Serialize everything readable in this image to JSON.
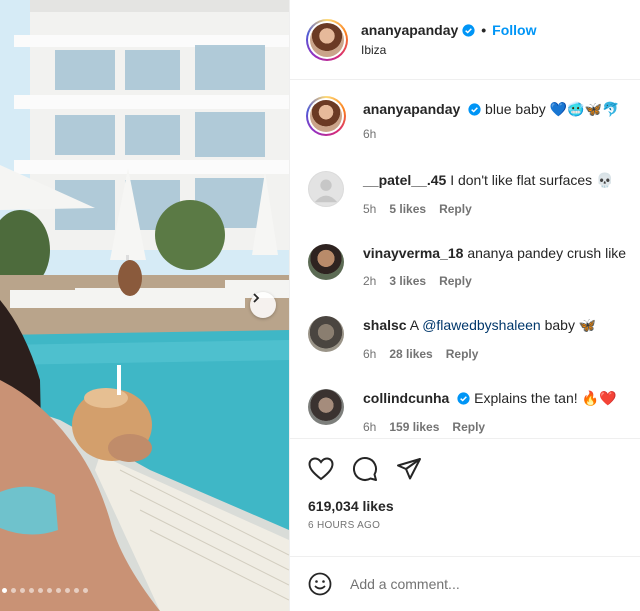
{
  "post": {
    "author": "ananyapanday",
    "follow_label": "Follow",
    "separator": "•",
    "location": "Ibiza"
  },
  "caption": {
    "username": "ananyapanday",
    "text": "blue baby",
    "emojis": "💙🥶🦋🐬",
    "time": "6h"
  },
  "comments": [
    {
      "username": "__patel__.45",
      "text": "I don't like flat surfaces",
      "emoji": "💀",
      "time": "5h",
      "likes": "5 likes",
      "reply": "Reply"
    },
    {
      "username": "vinayverma_18",
      "text": "ananya pandey crush like",
      "emoji": "",
      "time": "2h",
      "likes": "3 likes",
      "reply": "Reply"
    },
    {
      "username": "shalsc",
      "prefix": "A",
      "mention": "@flawedbyshaleen",
      "text": "baby",
      "emoji": "🦋",
      "time": "6h",
      "likes": "28 likes",
      "reply": "Reply"
    },
    {
      "username": "collindcunha",
      "text": "Explains the tan!",
      "emoji": "🔥❤️",
      "time": "6h",
      "likes": "159 likes",
      "reply": "Reply"
    }
  ],
  "stats": {
    "likes": "619,034 likes",
    "time_ago": "6 HOURS AGO"
  },
  "composer": {
    "placeholder": "Add a comment..."
  },
  "icons": {
    "like": "heart-icon",
    "comment": "comment-icon",
    "share": "share-icon",
    "emoji": "emoji-icon",
    "next": "chevron-right-icon",
    "verified": "verified-badge-icon"
  },
  "carousel": {
    "total_slides": 10,
    "active_index": 0
  },
  "colors": {
    "link": "#0095f6",
    "verified": "#0095f6",
    "text": "#262626",
    "muted": "#737373"
  }
}
